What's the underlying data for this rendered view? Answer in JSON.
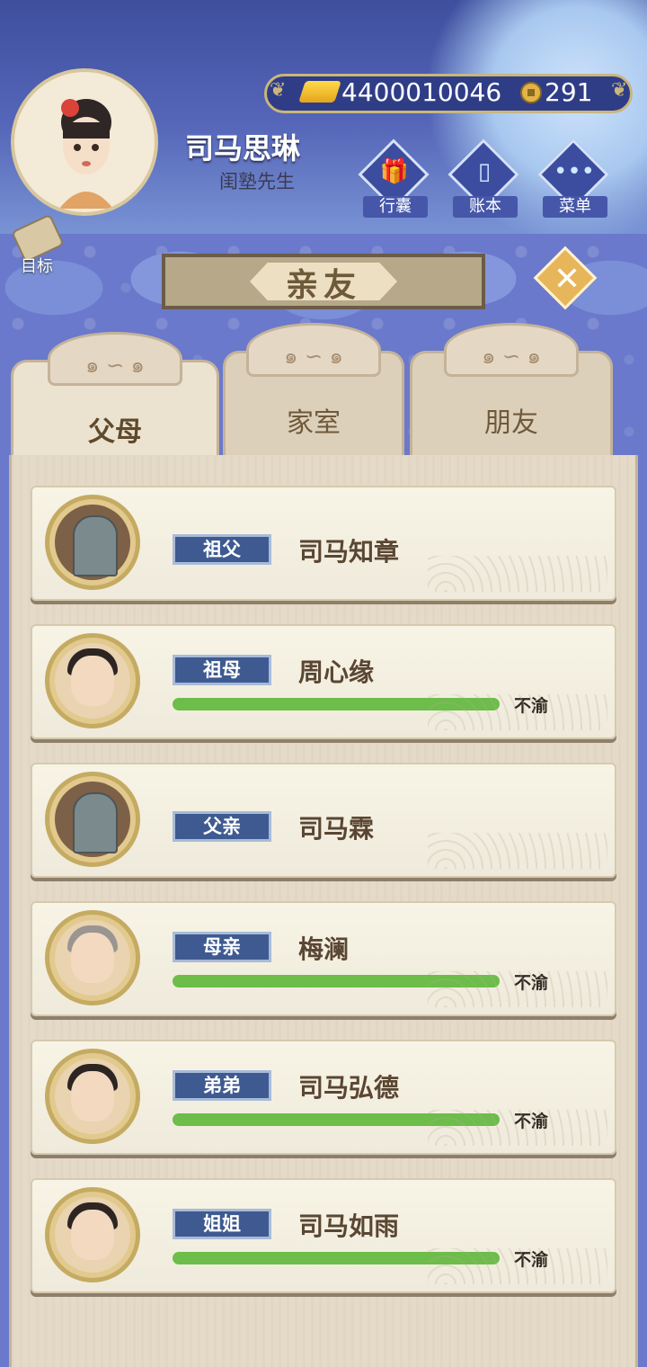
{
  "player": {
    "name": "司马思琳",
    "title": "闺塾先生"
  },
  "currency": {
    "gold": "4400010046",
    "coins": "291"
  },
  "menu": {
    "bag": "行囊",
    "ledger": "账本",
    "menu": "菜单",
    "goal": "目标"
  },
  "page_title": "亲友",
  "tabs": [
    {
      "label": "父母",
      "active": true
    },
    {
      "label": "家室",
      "active": false
    },
    {
      "label": "朋友",
      "active": false
    }
  ],
  "relatives": [
    {
      "relation": "祖父",
      "name": "司马知章",
      "deceased": true
    },
    {
      "relation": "祖母",
      "name": "周心缘",
      "status": "不渝",
      "affinity": 1.0
    },
    {
      "relation": "父亲",
      "name": "司马霖",
      "deceased": true
    },
    {
      "relation": "母亲",
      "name": "梅澜",
      "status": "不渝",
      "affinity": 1.0
    },
    {
      "relation": "弟弟",
      "name": "司马弘德",
      "status": "不渝",
      "affinity": 1.0
    },
    {
      "relation": "姐姐",
      "name": "司马如雨",
      "status": "不渝",
      "affinity": 1.0
    }
  ],
  "colors": {
    "affinity_bar": "#6cbd4a",
    "relation_badge": "#3e5a90"
  }
}
